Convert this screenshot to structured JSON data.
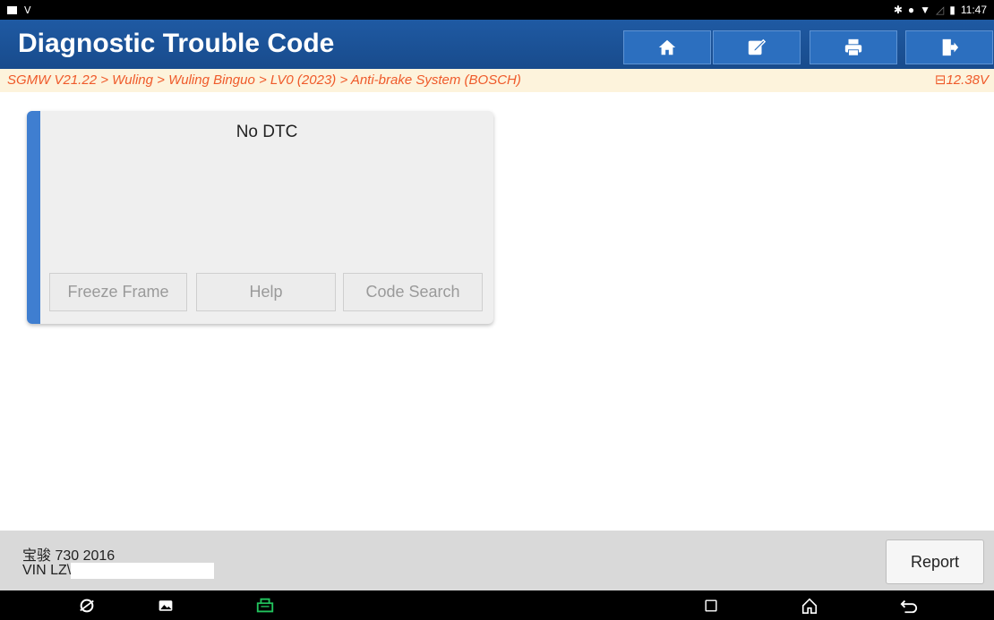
{
  "status_bar": {
    "time": "11:47"
  },
  "header": {
    "title": "Diagnostic Trouble Code",
    "icons": [
      "home-icon",
      "edit-icon",
      "print-icon",
      "exit-icon"
    ]
  },
  "breadcrumb": {
    "path": "SGMW V21.22 > Wuling > Wuling Binguo > LV0 (2023) > Anti-brake System (BOSCH)",
    "voltage": "12.38V"
  },
  "dtc_card": {
    "message": "No DTC",
    "buttons": {
      "freeze_frame": "Freeze Frame",
      "help": "Help",
      "code_search": "Code Search"
    }
  },
  "footer": {
    "vehicle": "宝骏 730 2016",
    "vin_label": "VIN LZ\\",
    "report_label": "Report"
  },
  "colors": {
    "header": "#1f5aa3",
    "breadcrumb_text": "#ef5a2a",
    "stripe": "#3f7ed0",
    "vci_icon": "#22c55e"
  }
}
